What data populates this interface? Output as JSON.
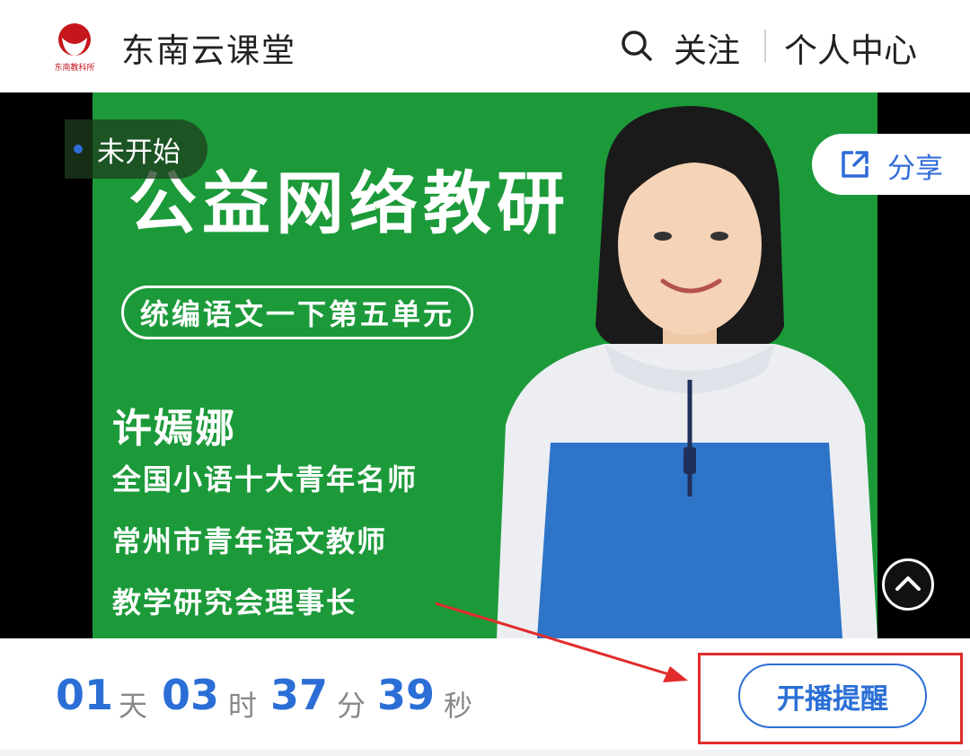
{
  "header": {
    "logo_caption": "东南教科所",
    "title": "东南云课堂",
    "follow_label": "关注",
    "profile_label": "个人中心",
    "search_icon": "search-icon"
  },
  "poster": {
    "title": "公益网络教研",
    "subtitle": "统编语文一下第五单元",
    "teacher_name": "许嫣娜",
    "credentials": [
      "全国小语十大青年名师",
      "常州市青年语文教师",
      "教学研究会理事长"
    ]
  },
  "status": {
    "label": "未开始",
    "dot_color": "#2f6bd8"
  },
  "share": {
    "label": "分享",
    "icon": "share-icon"
  },
  "countdown": {
    "days": "01",
    "days_unit": "天",
    "hours": "03",
    "hours_unit": "时",
    "minutes": "37",
    "minutes_unit": "分",
    "seconds": "39",
    "seconds_unit": "秒"
  },
  "remind_button": {
    "label": "开播提醒"
  },
  "colors": {
    "accent": "#2b6fd6",
    "poster_bg": "#1c9a3a",
    "annotation": "#e22c2c"
  }
}
